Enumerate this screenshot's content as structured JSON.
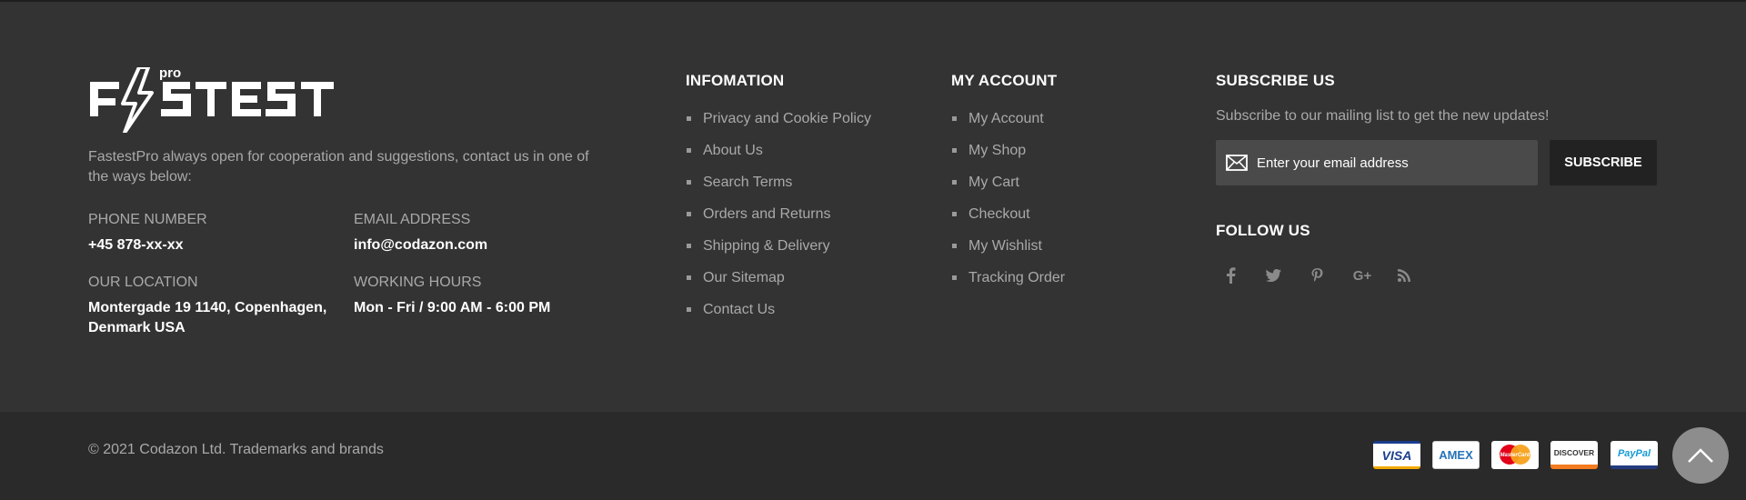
{
  "brand": {
    "logo_text": "FASTEST",
    "logo_superscript": "pro",
    "about": "FastestPro always open for cooperation and suggestions, contact us in one of the ways below:"
  },
  "contact": {
    "phone_label": "PHONE NUMBER",
    "phone_value": "+45 878-xx-xx",
    "email_label": "EMAIL ADDRESS",
    "email_value": "info@codazon.com",
    "location_label": "OUR LOCATION",
    "location_value": "Montergade 19 1140, Copenhagen, Denmark USA",
    "hours_label": "WORKING HOURS",
    "hours_value": "Mon - Fri / 9:00 AM - 6:00 PM"
  },
  "information": {
    "title": "INFOMATION",
    "links": [
      "Privacy and Cookie Policy",
      "About Us",
      "Search Terms",
      "Orders and Returns",
      "Shipping & Delivery",
      "Our Sitemap",
      "Contact Us"
    ]
  },
  "my_account": {
    "title": "MY ACCOUNT",
    "links": [
      "My Account",
      "My Shop",
      "My Cart",
      "Checkout",
      "My Wishlist",
      "Tracking Order"
    ]
  },
  "subscribe": {
    "title": "SUBSCRIBE US",
    "description": "Subscribe to our mailing list to get the new updates!",
    "placeholder": "Enter your email address",
    "button_label": "SUBSCRIBE"
  },
  "follow": {
    "title": "FOLLOW US",
    "icons": [
      "facebook-icon",
      "twitter-icon",
      "pinterest-icon",
      "google-plus-icon",
      "rss-icon"
    ],
    "google_plus_glyph": "G+"
  },
  "bottom": {
    "copyright": "© 2021 Codazon Ltd. Trademarks and brands",
    "payments": [
      "VISA",
      "AMEX",
      "MasterCard",
      "DISCOVER",
      "PayPal"
    ]
  },
  "colors": {
    "footer_bg": "#333333",
    "bottom_bar_bg": "#2a2a2a",
    "text_muted": "#a9a9a9",
    "heading": "#ffffff",
    "input_bg": "#4a4a4a",
    "button_bg": "#222222",
    "back_to_top_bg": "#8d8d8d"
  }
}
